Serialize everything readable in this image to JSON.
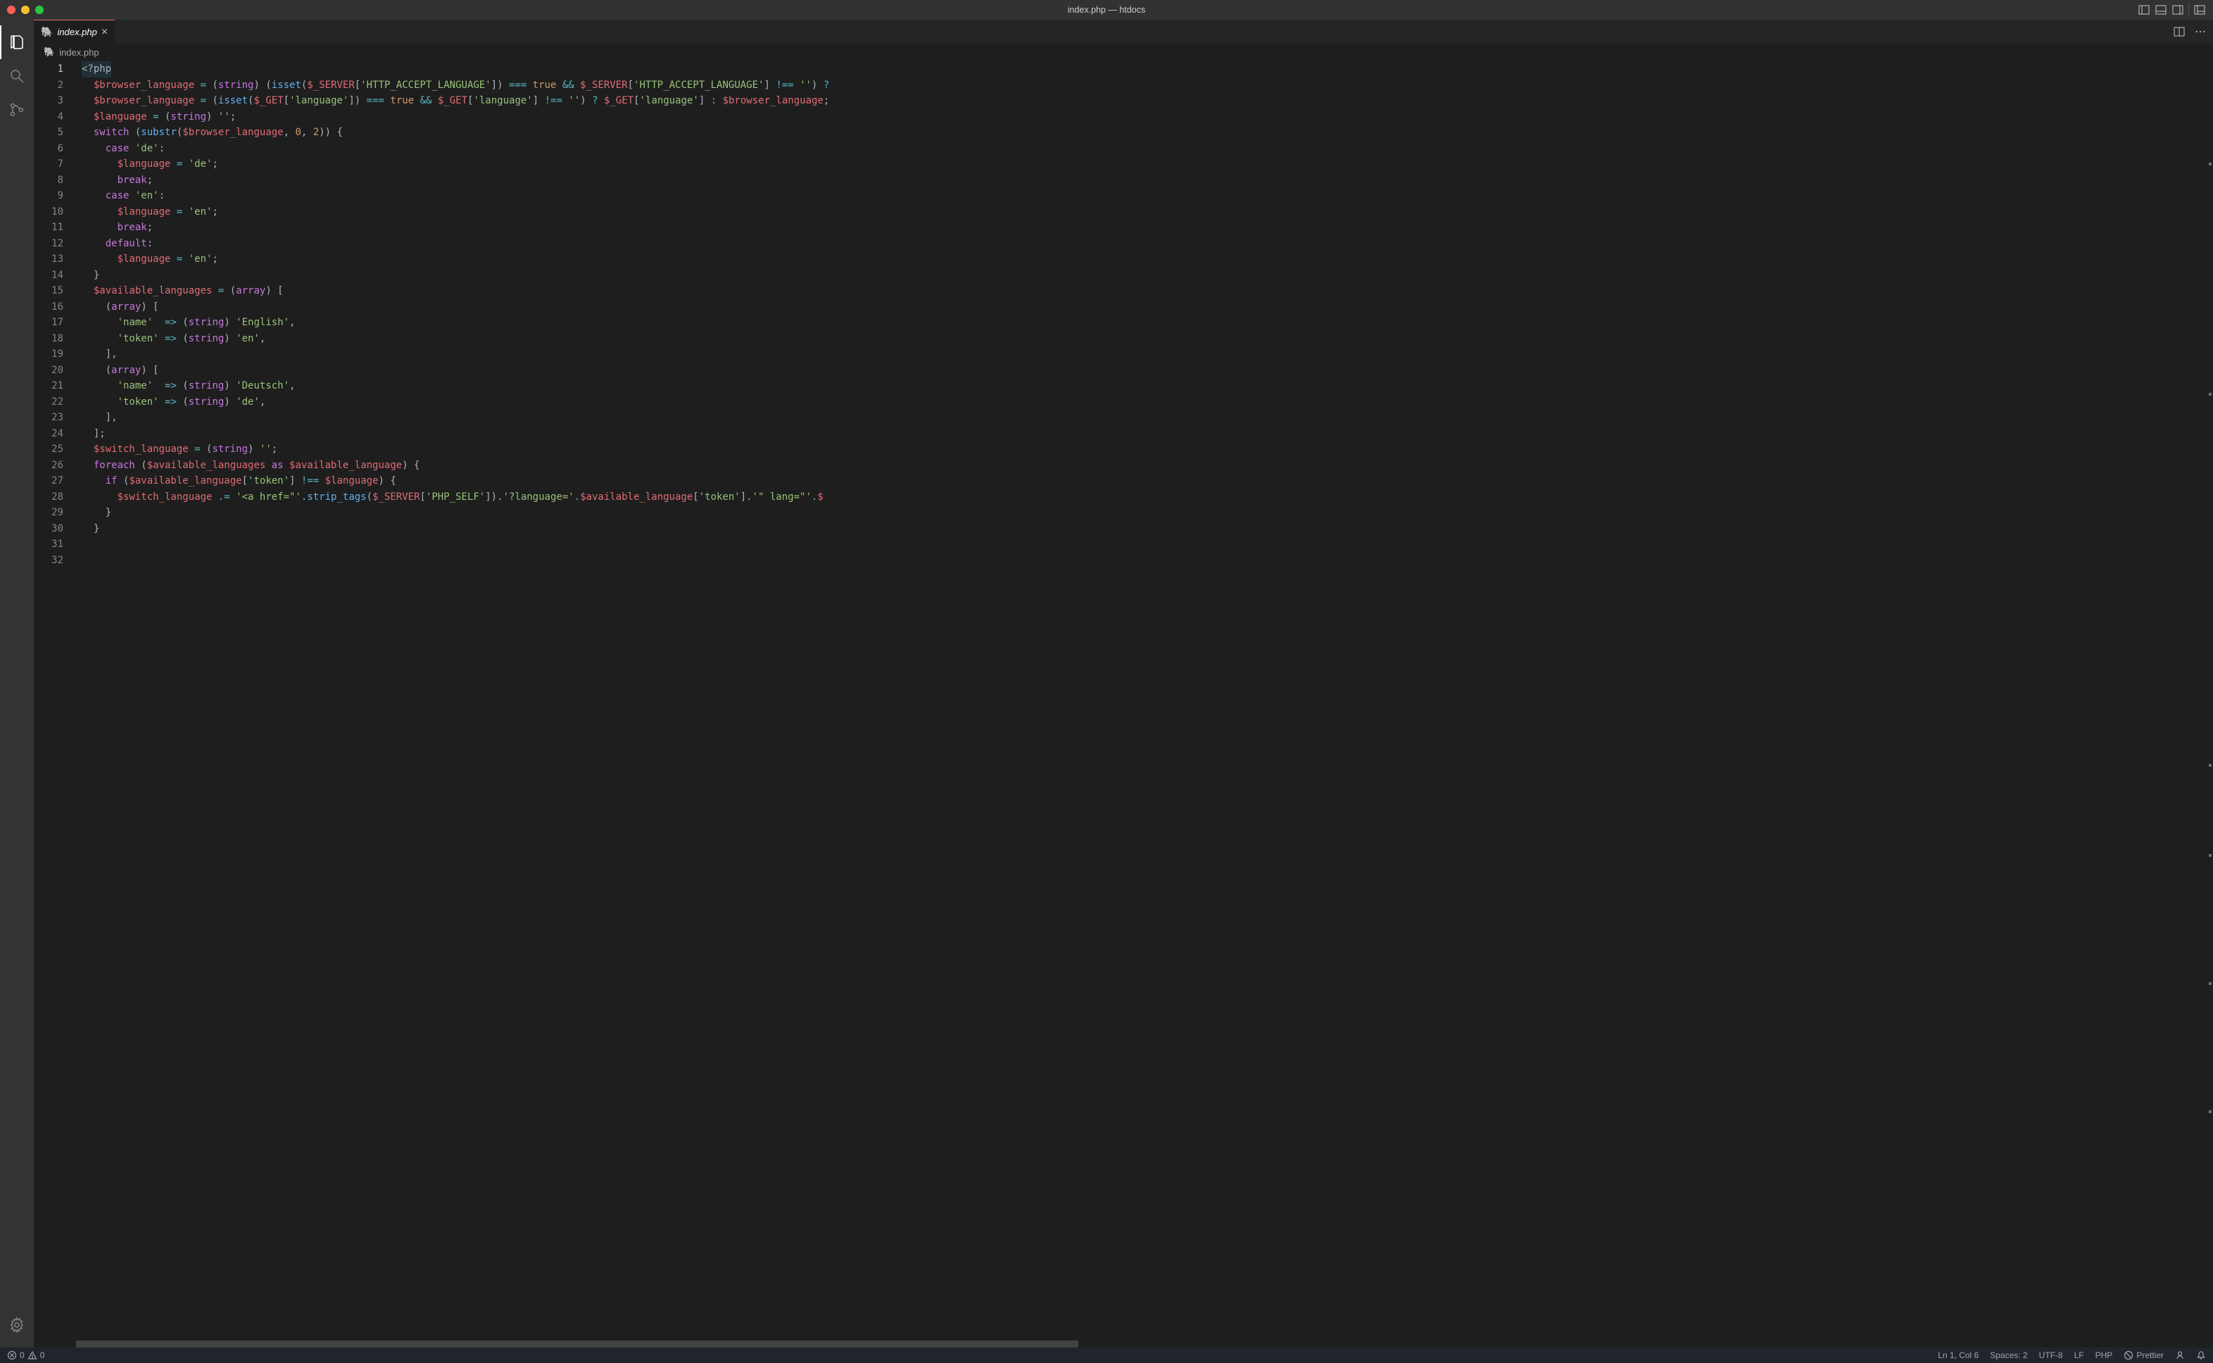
{
  "window": {
    "title": "index.php — htdocs"
  },
  "tab": {
    "icon": "🐘",
    "name": "index.php"
  },
  "breadcrumb": {
    "icon": "🐘",
    "text": "index.php"
  },
  "code": {
    "lines": [
      [
        {
          "t": "<?php",
          "c": "line-highlight tok-def"
        }
      ],
      [
        {
          "t": "  ",
          "c": ""
        },
        {
          "t": "$browser_language",
          "c": "tok-var"
        },
        {
          "t": " ",
          "c": ""
        },
        {
          "t": "=",
          "c": "tok-op"
        },
        {
          "t": " (",
          "c": "tok-punc"
        },
        {
          "t": "string",
          "c": "tok-type"
        },
        {
          "t": ") (",
          "c": "tok-punc"
        },
        {
          "t": "isset",
          "c": "tok-fn"
        },
        {
          "t": "(",
          "c": "tok-punc"
        },
        {
          "t": "$_SERVER",
          "c": "tok-var"
        },
        {
          "t": "[",
          "c": "tok-punc"
        },
        {
          "t": "'HTTP_ACCEPT_LANGUAGE'",
          "c": "tok-str"
        },
        {
          "t": "]) ",
          "c": "tok-punc"
        },
        {
          "t": "===",
          "c": "tok-op"
        },
        {
          "t": " ",
          "c": ""
        },
        {
          "t": "true",
          "c": "tok-const"
        },
        {
          "t": " ",
          "c": ""
        },
        {
          "t": "&&",
          "c": "tok-op"
        },
        {
          "t": " ",
          "c": ""
        },
        {
          "t": "$_SERVER",
          "c": "tok-var"
        },
        {
          "t": "[",
          "c": "tok-punc"
        },
        {
          "t": "'HTTP_ACCEPT_LANGUAGE'",
          "c": "tok-str"
        },
        {
          "t": "] ",
          "c": "tok-punc"
        },
        {
          "t": "!==",
          "c": "tok-op"
        },
        {
          "t": " ",
          "c": ""
        },
        {
          "t": "''",
          "c": "tok-str"
        },
        {
          "t": ") ",
          "c": "tok-punc"
        },
        {
          "t": "?",
          "c": "tok-op"
        }
      ],
      [
        {
          "t": "  ",
          "c": ""
        },
        {
          "t": "$browser_language",
          "c": "tok-var"
        },
        {
          "t": " ",
          "c": ""
        },
        {
          "t": "=",
          "c": "tok-op"
        },
        {
          "t": " (",
          "c": "tok-punc"
        },
        {
          "t": "isset",
          "c": "tok-fn"
        },
        {
          "t": "(",
          "c": "tok-punc"
        },
        {
          "t": "$_GET",
          "c": "tok-var"
        },
        {
          "t": "[",
          "c": "tok-punc"
        },
        {
          "t": "'language'",
          "c": "tok-str"
        },
        {
          "t": "]) ",
          "c": "tok-punc"
        },
        {
          "t": "===",
          "c": "tok-op"
        },
        {
          "t": " ",
          "c": ""
        },
        {
          "t": "true",
          "c": "tok-const"
        },
        {
          "t": " ",
          "c": ""
        },
        {
          "t": "&&",
          "c": "tok-op"
        },
        {
          "t": " ",
          "c": ""
        },
        {
          "t": "$_GET",
          "c": "tok-var"
        },
        {
          "t": "[",
          "c": "tok-punc"
        },
        {
          "t": "'language'",
          "c": "tok-str"
        },
        {
          "t": "] ",
          "c": "tok-punc"
        },
        {
          "t": "!==",
          "c": "tok-op"
        },
        {
          "t": " ",
          "c": ""
        },
        {
          "t": "''",
          "c": "tok-str"
        },
        {
          "t": ") ",
          "c": "tok-punc"
        },
        {
          "t": "?",
          "c": "tok-op"
        },
        {
          "t": " ",
          "c": ""
        },
        {
          "t": "$_GET",
          "c": "tok-var"
        },
        {
          "t": "[",
          "c": "tok-punc"
        },
        {
          "t": "'language'",
          "c": "tok-str"
        },
        {
          "t": "] ",
          "c": "tok-punc"
        },
        {
          "t": ":",
          "c": "tok-op"
        },
        {
          "t": " ",
          "c": ""
        },
        {
          "t": "$browser_language",
          "c": "tok-var"
        },
        {
          "t": ";",
          "c": "tok-punc"
        }
      ],
      [
        {
          "t": "  ",
          "c": ""
        },
        {
          "t": "$language",
          "c": "tok-var"
        },
        {
          "t": " ",
          "c": ""
        },
        {
          "t": "=",
          "c": "tok-op"
        },
        {
          "t": " (",
          "c": "tok-punc"
        },
        {
          "t": "string",
          "c": "tok-type"
        },
        {
          "t": ") ",
          "c": "tok-punc"
        },
        {
          "t": "''",
          "c": "tok-str"
        },
        {
          "t": ";",
          "c": "tok-punc"
        }
      ],
      [
        {
          "t": "  ",
          "c": ""
        },
        {
          "t": "switch",
          "c": "tok-kw"
        },
        {
          "t": " (",
          "c": "tok-punc"
        },
        {
          "t": "substr",
          "c": "tok-fn"
        },
        {
          "t": "(",
          "c": "tok-punc"
        },
        {
          "t": "$browser_language",
          "c": "tok-var"
        },
        {
          "t": ", ",
          "c": "tok-punc"
        },
        {
          "t": "0",
          "c": "tok-num"
        },
        {
          "t": ", ",
          "c": "tok-punc"
        },
        {
          "t": "2",
          "c": "tok-num"
        },
        {
          "t": ")) {",
          "c": "tok-punc"
        }
      ],
      [
        {
          "t": "    ",
          "c": ""
        },
        {
          "t": "case",
          "c": "tok-kw"
        },
        {
          "t": " ",
          "c": ""
        },
        {
          "t": "'de'",
          "c": "tok-str"
        },
        {
          "t": ":",
          "c": "tok-punc"
        }
      ],
      [
        {
          "t": "      ",
          "c": ""
        },
        {
          "t": "$language",
          "c": "tok-var"
        },
        {
          "t": " ",
          "c": ""
        },
        {
          "t": "=",
          "c": "tok-op"
        },
        {
          "t": " ",
          "c": ""
        },
        {
          "t": "'de'",
          "c": "tok-str"
        },
        {
          "t": ";",
          "c": "tok-punc"
        }
      ],
      [
        {
          "t": "      ",
          "c": ""
        },
        {
          "t": "break",
          "c": "tok-kw"
        },
        {
          "t": ";",
          "c": "tok-punc"
        }
      ],
      [
        {
          "t": "    ",
          "c": ""
        },
        {
          "t": "case",
          "c": "tok-kw"
        },
        {
          "t": " ",
          "c": ""
        },
        {
          "t": "'en'",
          "c": "tok-str"
        },
        {
          "t": ":",
          "c": "tok-punc"
        }
      ],
      [
        {
          "t": "      ",
          "c": ""
        },
        {
          "t": "$language",
          "c": "tok-var"
        },
        {
          "t": " ",
          "c": ""
        },
        {
          "t": "=",
          "c": "tok-op"
        },
        {
          "t": " ",
          "c": ""
        },
        {
          "t": "'en'",
          "c": "tok-str"
        },
        {
          "t": ";",
          "c": "tok-punc"
        }
      ],
      [
        {
          "t": "      ",
          "c": ""
        },
        {
          "t": "break",
          "c": "tok-kw"
        },
        {
          "t": ";",
          "c": "tok-punc"
        }
      ],
      [
        {
          "t": "    ",
          "c": ""
        },
        {
          "t": "default",
          "c": "tok-kw"
        },
        {
          "t": ":",
          "c": "tok-punc"
        }
      ],
      [
        {
          "t": "      ",
          "c": ""
        },
        {
          "t": "$language",
          "c": "tok-var"
        },
        {
          "t": " ",
          "c": ""
        },
        {
          "t": "=",
          "c": "tok-op"
        },
        {
          "t": " ",
          "c": ""
        },
        {
          "t": "'en'",
          "c": "tok-str"
        },
        {
          "t": ";",
          "c": "tok-punc"
        }
      ],
      [
        {
          "t": "  }",
          "c": "tok-punc"
        }
      ],
      [
        {
          "t": "",
          "c": ""
        }
      ],
      [
        {
          "t": "  ",
          "c": ""
        },
        {
          "t": "$available_languages",
          "c": "tok-var"
        },
        {
          "t": " ",
          "c": ""
        },
        {
          "t": "=",
          "c": "tok-op"
        },
        {
          "t": " (",
          "c": "tok-punc"
        },
        {
          "t": "array",
          "c": "tok-type"
        },
        {
          "t": ") [",
          "c": "tok-punc"
        }
      ],
      [
        {
          "t": "    (",
          "c": "tok-punc"
        },
        {
          "t": "array",
          "c": "tok-type"
        },
        {
          "t": ") [",
          "c": "tok-punc"
        }
      ],
      [
        {
          "t": "      ",
          "c": ""
        },
        {
          "t": "'name'",
          "c": "tok-str"
        },
        {
          "t": "  ",
          "c": ""
        },
        {
          "t": "=>",
          "c": "tok-op"
        },
        {
          "t": " (",
          "c": "tok-punc"
        },
        {
          "t": "string",
          "c": "tok-type"
        },
        {
          "t": ") ",
          "c": "tok-punc"
        },
        {
          "t": "'English'",
          "c": "tok-str"
        },
        {
          "t": ",",
          "c": "tok-punc"
        }
      ],
      [
        {
          "t": "      ",
          "c": ""
        },
        {
          "t": "'token'",
          "c": "tok-str"
        },
        {
          "t": " ",
          "c": ""
        },
        {
          "t": "=>",
          "c": "tok-op"
        },
        {
          "t": " (",
          "c": "tok-punc"
        },
        {
          "t": "string",
          "c": "tok-type"
        },
        {
          "t": ") ",
          "c": "tok-punc"
        },
        {
          "t": "'en'",
          "c": "tok-str"
        },
        {
          "t": ",",
          "c": "tok-punc"
        }
      ],
      [
        {
          "t": "    ],",
          "c": "tok-punc"
        }
      ],
      [
        {
          "t": "    (",
          "c": "tok-punc"
        },
        {
          "t": "array",
          "c": "tok-type"
        },
        {
          "t": ") [",
          "c": "tok-punc"
        }
      ],
      [
        {
          "t": "      ",
          "c": ""
        },
        {
          "t": "'name'",
          "c": "tok-str"
        },
        {
          "t": "  ",
          "c": ""
        },
        {
          "t": "=>",
          "c": "tok-op"
        },
        {
          "t": " (",
          "c": "tok-punc"
        },
        {
          "t": "string",
          "c": "tok-type"
        },
        {
          "t": ") ",
          "c": "tok-punc"
        },
        {
          "t": "'Deutsch'",
          "c": "tok-str"
        },
        {
          "t": ",",
          "c": "tok-punc"
        }
      ],
      [
        {
          "t": "      ",
          "c": ""
        },
        {
          "t": "'token'",
          "c": "tok-str"
        },
        {
          "t": " ",
          "c": ""
        },
        {
          "t": "=>",
          "c": "tok-op"
        },
        {
          "t": " (",
          "c": "tok-punc"
        },
        {
          "t": "string",
          "c": "tok-type"
        },
        {
          "t": ") ",
          "c": "tok-punc"
        },
        {
          "t": "'de'",
          "c": "tok-str"
        },
        {
          "t": ",",
          "c": "tok-punc"
        }
      ],
      [
        {
          "t": "    ],",
          "c": "tok-punc"
        }
      ],
      [
        {
          "t": "  ];",
          "c": "tok-punc"
        }
      ],
      [
        {
          "t": "",
          "c": ""
        }
      ],
      [
        {
          "t": "  ",
          "c": ""
        },
        {
          "t": "$switch_language",
          "c": "tok-var"
        },
        {
          "t": " ",
          "c": ""
        },
        {
          "t": "=",
          "c": "tok-op"
        },
        {
          "t": " (",
          "c": "tok-punc"
        },
        {
          "t": "string",
          "c": "tok-type"
        },
        {
          "t": ") ",
          "c": "tok-punc"
        },
        {
          "t": "''",
          "c": "tok-str"
        },
        {
          "t": ";",
          "c": "tok-punc"
        }
      ],
      [
        {
          "t": "  ",
          "c": ""
        },
        {
          "t": "foreach",
          "c": "tok-kw"
        },
        {
          "t": " (",
          "c": "tok-punc"
        },
        {
          "t": "$available_languages",
          "c": "tok-var"
        },
        {
          "t": " ",
          "c": ""
        },
        {
          "t": "as",
          "c": "tok-kw"
        },
        {
          "t": " ",
          "c": ""
        },
        {
          "t": "$available_language",
          "c": "tok-var"
        },
        {
          "t": ") {",
          "c": "tok-punc"
        }
      ],
      [
        {
          "t": "    ",
          "c": ""
        },
        {
          "t": "if",
          "c": "tok-kw"
        },
        {
          "t": " (",
          "c": "tok-punc"
        },
        {
          "t": "$available_language",
          "c": "tok-var"
        },
        {
          "t": "[",
          "c": "tok-punc"
        },
        {
          "t": "'token'",
          "c": "tok-str"
        },
        {
          "t": "] ",
          "c": "tok-punc"
        },
        {
          "t": "!==",
          "c": "tok-op"
        },
        {
          "t": " ",
          "c": ""
        },
        {
          "t": "$language",
          "c": "tok-var"
        },
        {
          "t": ") {",
          "c": "tok-punc"
        }
      ],
      [
        {
          "t": "      ",
          "c": ""
        },
        {
          "t": "$switch_language",
          "c": "tok-var"
        },
        {
          "t": " ",
          "c": ""
        },
        {
          "t": ".=",
          "c": "tok-op"
        },
        {
          "t": " ",
          "c": ""
        },
        {
          "t": "'<a href=\"'",
          "c": "tok-str"
        },
        {
          "t": ".",
          "c": "tok-op"
        },
        {
          "t": "strip_tags",
          "c": "tok-fn"
        },
        {
          "t": "(",
          "c": "tok-punc"
        },
        {
          "t": "$_SERVER",
          "c": "tok-var"
        },
        {
          "t": "[",
          "c": "tok-punc"
        },
        {
          "t": "'PHP_SELF'",
          "c": "tok-str"
        },
        {
          "t": "]).",
          "c": "tok-punc"
        },
        {
          "t": "'?language='",
          "c": "tok-str"
        },
        {
          "t": ".",
          "c": "tok-op"
        },
        {
          "t": "$available_language",
          "c": "tok-var"
        },
        {
          "t": "[",
          "c": "tok-punc"
        },
        {
          "t": "'token'",
          "c": "tok-str"
        },
        {
          "t": "].",
          "c": "tok-punc"
        },
        {
          "t": "'\" lang=\"'",
          "c": "tok-str"
        },
        {
          "t": ".",
          "c": "tok-op"
        },
        {
          "t": "$",
          "c": "tok-var"
        }
      ],
      [
        {
          "t": "    }",
          "c": "tok-punc"
        }
      ],
      [
        {
          "t": "  }",
          "c": "tok-punc"
        }
      ]
    ]
  },
  "status": {
    "errors": "0",
    "warnings": "0",
    "ln_col": "Ln 1, Col 6",
    "spaces": "Spaces: 2",
    "encoding": "UTF-8",
    "eol": "LF",
    "lang": "PHP",
    "prettier": "Prettier"
  }
}
